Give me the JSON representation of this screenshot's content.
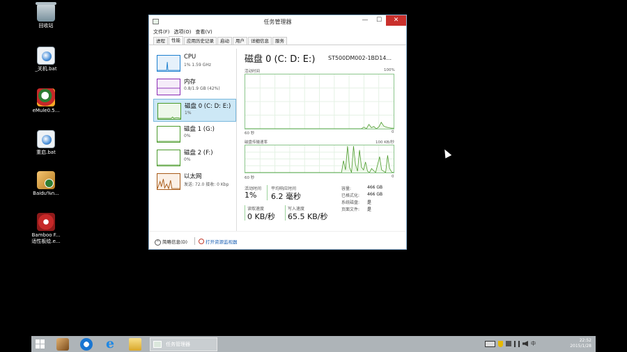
{
  "desktop": {
    "icons": [
      {
        "label": "回收站"
      },
      {
        "label": "_关机.bat"
      },
      {
        "label": "eMule0.5..."
      },
      {
        "label": "重启.bat"
      },
      {
        "label": "Baidu%n..."
      },
      {
        "label": "Bamboo F...",
        "label2": "适性板绘.e..."
      }
    ]
  },
  "window": {
    "title": "任务管理器",
    "controls": {
      "minimize": "—",
      "maximize": "☐",
      "close": "✕"
    },
    "menu": [
      "文件(F)",
      "选项(O)",
      "查看(V)"
    ],
    "tabs": [
      "进程",
      "性能",
      "应用历史记录",
      "启动",
      "用户",
      "详细信息",
      "服务"
    ],
    "active_tab": 1
  },
  "resources": [
    {
      "name": "CPU",
      "sub": "1% 1.59 GHz",
      "color": "#1c7fcf",
      "fill": "#e6f1fb"
    },
    {
      "name": "内存",
      "sub": "0.8/1.9 GB (42%)",
      "color": "#8b2bb4",
      "fill": "#f5ecf9"
    },
    {
      "name": "磁盘 0 (C: D: E:)",
      "sub": "1%",
      "color": "#4a9a2a",
      "fill": "#eef8ea"
    },
    {
      "name": "磁盘 1 (G:)",
      "sub": "0%",
      "color": "#4a9a2a",
      "fill": "#ffffff"
    },
    {
      "name": "磁盘 2 (F:)",
      "sub": "0%",
      "color": "#4a9a2a",
      "fill": "#ffffff"
    },
    {
      "name": "以太网",
      "sub": "发送: 72.0 接收: 0 Kbp",
      "color": "#a75a17",
      "fill": "#fbf0e6"
    }
  ],
  "detail": {
    "title": "磁盘 0 (C: D: E:)",
    "model": "ST500DM002-1BD14...",
    "graph1": {
      "label_left": "活动时间",
      "label_right": "100%",
      "x_left": "60 秒",
      "x_right": "0"
    },
    "graph2": {
      "label_left": "磁盘传输速率",
      "label_right": "100 KB/秒",
      "x_left": "60 秒",
      "x_right": "0"
    },
    "stats": {
      "active_label": "活动时间",
      "active_value": "1%",
      "response_label": "平均响应时间",
      "response_value": "6.2 毫秒",
      "read_label": "读取速度",
      "read_value": "0 KB/秒",
      "write_label": "写入速度",
      "write_value": "65.5 KB/秒"
    },
    "props": [
      {
        "label": "容量:",
        "value": "466 GB"
      },
      {
        "label": "已格式化:",
        "value": "466 GB"
      },
      {
        "label": "系统磁盘:",
        "value": "是"
      },
      {
        "label": "页面文件:",
        "value": "是"
      }
    ]
  },
  "footer": {
    "less_details": "简略信息(D)",
    "open_monitor": "打开资源监视器"
  },
  "taskbar": {
    "task_label": "任务管理器",
    "ime": "中",
    "time": "22:52",
    "date": "2015/1/28"
  },
  "chart_data": [
    {
      "type": "area",
      "title": "活动时间",
      "x": [
        60,
        0
      ],
      "ylim": [
        0,
        100
      ],
      "values": [
        0,
        0,
        0,
        0,
        0,
        0,
        0,
        0,
        0,
        0,
        0,
        0,
        0,
        0,
        0,
        0,
        0,
        0,
        0,
        0,
        0,
        0,
        0,
        0,
        0,
        0,
        0,
        0,
        0,
        0,
        0,
        0,
        0,
        0,
        0,
        0,
        0,
        0,
        0,
        0,
        0,
        0,
        0,
        0,
        0,
        0,
        0,
        0,
        3,
        0,
        8,
        2,
        4,
        0,
        3,
        12,
        5,
        3,
        2,
        1,
        1
      ]
    },
    {
      "type": "area",
      "title": "磁盘传输速率",
      "x": [
        60,
        0
      ],
      "ylim": [
        0,
        100
      ],
      "values": [
        0,
        0,
        0,
        0,
        0,
        0,
        0,
        0,
        0,
        0,
        0,
        0,
        0,
        0,
        0,
        0,
        0,
        0,
        0,
        0,
        0,
        0,
        0,
        0,
        0,
        0,
        0,
        0,
        0,
        0,
        0,
        0,
        0,
        0,
        0,
        0,
        0,
        0,
        0,
        0,
        0,
        0,
        0,
        0,
        0,
        0,
        0,
        0,
        0,
        45,
        10,
        100,
        20,
        0,
        100,
        30,
        5,
        85,
        20,
        10,
        40,
        5,
        0,
        15,
        8,
        0,
        30,
        60,
        10,
        5,
        0,
        65,
        15,
        2,
        0
      ]
    }
  ]
}
